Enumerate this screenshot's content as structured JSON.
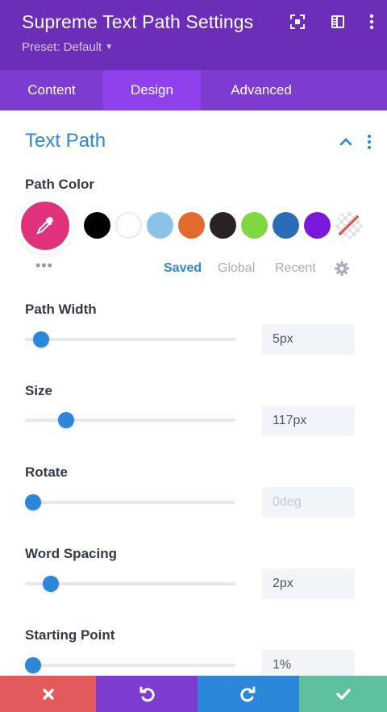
{
  "header": {
    "title": "Supreme Text Path Settings",
    "preset": "Preset: Default",
    "icons": [
      "fullscreen-icon",
      "split-view-icon",
      "more-vertical-icon"
    ]
  },
  "tabs": [
    {
      "label": "Content",
      "active": false
    },
    {
      "label": "Design",
      "active": true
    },
    {
      "label": "Advanced",
      "active": false
    }
  ],
  "section": {
    "title": "Text Path"
  },
  "path_color": {
    "label": "Path Color",
    "current_color": "#e0317c",
    "swatches": [
      "#000000",
      "#ffffff",
      "#8ac3e8",
      "#e26a2c",
      "#2a2325",
      "#81d742",
      "#2b6cb8",
      "#7a18dc",
      "transparent"
    ],
    "more": "•••",
    "palette_tabs": [
      "Saved",
      "Global",
      "Recent"
    ],
    "active_palette": "Saved"
  },
  "sliders": [
    {
      "label": "Path Width",
      "value": "5px",
      "position": 0.04,
      "disabled": false
    },
    {
      "label": "Size",
      "value": "117px",
      "position": 0.17,
      "disabled": false
    },
    {
      "label": "Rotate",
      "value": "0deg",
      "position": 0.0,
      "disabled": true
    },
    {
      "label": "Word Spacing",
      "value": "2px",
      "position": 0.09,
      "disabled": false
    },
    {
      "label": "Starting Point",
      "value": "1%",
      "position": 0.0,
      "disabled": false
    }
  ],
  "footer": {
    "buttons": [
      {
        "name": "discard-button",
        "icon": "close-icon",
        "color": "#e25a5a"
      },
      {
        "name": "undo-button",
        "icon": "undo-icon",
        "color": "#7d3bcf"
      },
      {
        "name": "redo-button",
        "icon": "redo-icon",
        "color": "#2b87da"
      },
      {
        "name": "save-button",
        "icon": "check-icon",
        "color": "#5ec09f"
      }
    ]
  },
  "colors": {
    "header_bg": "#6c2eb9",
    "tabs_bg": "#7d3bcf",
    "tab_active_bg": "#8f42ec",
    "accent": "#2b87da"
  }
}
